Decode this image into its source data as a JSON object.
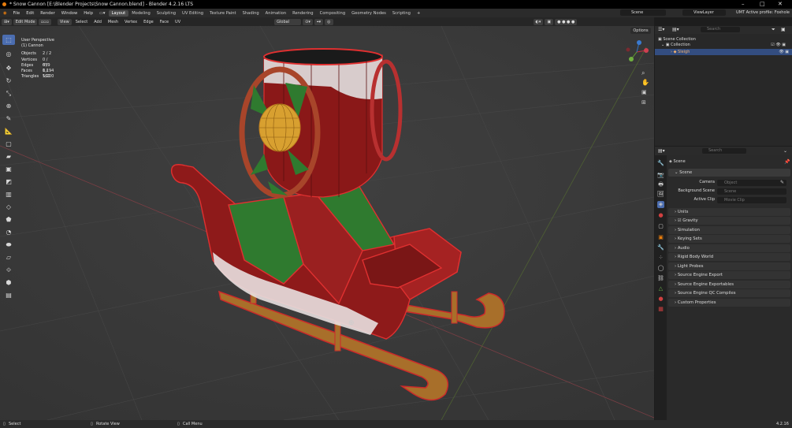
{
  "window": {
    "title": "* Snow Cannon [E:\\Blender Projects\\Snow Cannon.blend] - Blender 4.2.16 LTS"
  },
  "menu": [
    "File",
    "Edit",
    "Render",
    "Window",
    "Help"
  ],
  "workspaces": [
    "Layout",
    "Modeling",
    "Sculpting",
    "UV Editing",
    "Texture Paint",
    "Shading",
    "Animation",
    "Rendering",
    "Compositing",
    "Geometry Nodes",
    "Scripting"
  ],
  "top_right": {
    "scene": "Scene",
    "view_layer": "ViewLayer",
    "profile": "UMT Active profile: Foxhole"
  },
  "header": {
    "mode": "Edit Mode",
    "view": "View",
    "select": "Select",
    "add": "Add",
    "mesh": "Mesh",
    "vertex": "Vertex",
    "edge": "Edge",
    "face": "Face",
    "uv": "UV",
    "orientation": "Global",
    "options": "Options"
  },
  "viewport": {
    "perspective": "User Perspective",
    "object": "(1) Cannon",
    "stats": [
      {
        "label": "Objects",
        "value": "2 / 2"
      },
      {
        "label": "Vertices",
        "value": "0 / 659"
      },
      {
        "label": "Edges",
        "value": "0 / 1,194"
      },
      {
        "label": "Faces",
        "value": "0 / 562"
      },
      {
        "label": "Triangles",
        "value": "1,220"
      }
    ]
  },
  "outliner": {
    "search_placeholder": "Search",
    "items": [
      "Scene Collection",
      "Collection",
      "Sleigh"
    ]
  },
  "properties": {
    "search_placeholder": "Search",
    "breadcrumb": "Scene",
    "panel_open": "Scene",
    "fields": [
      {
        "label": "Camera",
        "placeholder": "Object"
      },
      {
        "label": "Background Scene",
        "placeholder": "Scene"
      },
      {
        "label": "Active Clip",
        "placeholder": "Movie Clip"
      }
    ],
    "panels": [
      "Units",
      "Gravity",
      "Simulation",
      "Keying Sets",
      "Audio",
      "Rigid Body World",
      "Light Probes",
      "Source Engine Export",
      "Source Engine Exportables",
      "Source Engine QC Compiles",
      "Custom Properties"
    ]
  },
  "statusbar": {
    "select": "Select",
    "rotate": "Rotate View",
    "call_menu": "Call Menu",
    "version": "4.2.16"
  }
}
